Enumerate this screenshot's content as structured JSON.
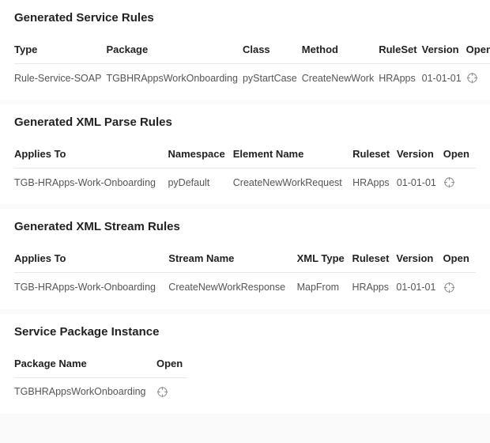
{
  "sections": {
    "service_rules": {
      "title": "Generated Service Rules",
      "headers": {
        "type": "Type",
        "package": "Package",
        "class": "Class",
        "method": "Method",
        "ruleset": "RuleSet",
        "version": "Version",
        "open": "Open"
      },
      "rows": [
        {
          "type": "Rule-Service-SOAP",
          "package": "TGBHRAppsWorkOnboarding",
          "class": "pyStartCase",
          "method": "CreateNewWork",
          "ruleset": "HRApps",
          "version": "01-01-01"
        }
      ]
    },
    "xml_parse_rules": {
      "title": "Generated XML Parse Rules",
      "headers": {
        "applies_to": "Applies To",
        "namespace": "Namespace",
        "element_name": "Element Name",
        "ruleset": "Ruleset",
        "version": "Version",
        "open": "Open"
      },
      "rows": [
        {
          "applies_to": "TGB-HRApps-Work-Onboarding",
          "namespace": "pyDefault",
          "element_name": "CreateNewWorkRequest",
          "ruleset": "HRApps",
          "version": "01-01-01"
        }
      ]
    },
    "xml_stream_rules": {
      "title": "Generated XML Stream Rules",
      "headers": {
        "applies_to": "Applies To",
        "stream_name": "Stream Name",
        "xml_type": "XML Type",
        "ruleset": "Ruleset",
        "version": "Version",
        "open": "Open"
      },
      "rows": [
        {
          "applies_to": "TGB-HRApps-Work-Onboarding",
          "stream_name": "CreateNewWorkResponse",
          "xml_type": "MapFrom",
          "ruleset": "HRApps",
          "version": "01-01-01"
        }
      ]
    },
    "service_package": {
      "title": "Service Package Instance",
      "headers": {
        "package_name": "Package Name",
        "open": "Open"
      },
      "rows": [
        {
          "package_name": "TGBHRAppsWorkOnboarding"
        }
      ]
    }
  }
}
